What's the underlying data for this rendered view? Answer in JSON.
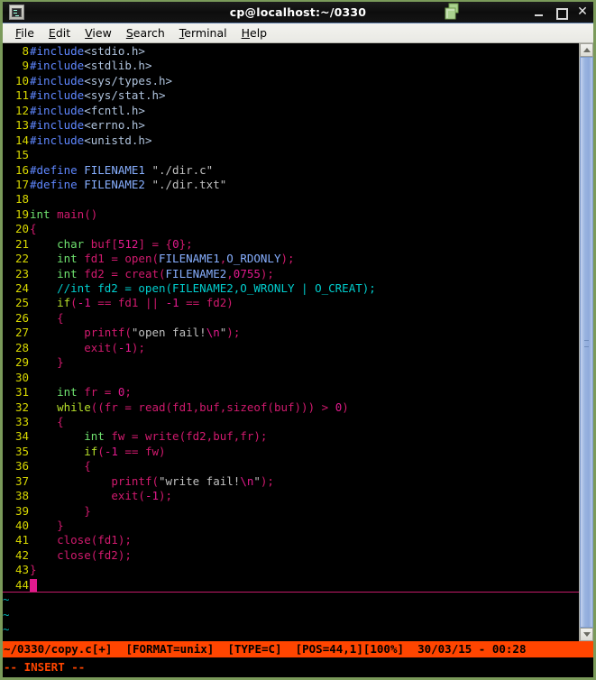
{
  "window": {
    "title": "cp@localhost:~/0330",
    "icon": "terminal-icon",
    "copy_icon": "copy-windows-icon",
    "controls": {
      "minimize": "_",
      "maximize": "□",
      "close": "✕"
    }
  },
  "menubar": {
    "items": [
      {
        "name": "file",
        "mnemonic": "F",
        "rest": "ile"
      },
      {
        "name": "edit",
        "mnemonic": "E",
        "rest": "dit"
      },
      {
        "name": "view",
        "mnemonic": "V",
        "rest": "iew"
      },
      {
        "name": "search",
        "mnemonic": "S",
        "rest": "earch"
      },
      {
        "name": "terminal",
        "mnemonic": "T",
        "rest": "erminal"
      },
      {
        "name": "help",
        "mnemonic": "H",
        "rest": "elp"
      }
    ]
  },
  "editor": {
    "first_line": 8,
    "lines": [
      {
        "n": 8,
        "tokens": [
          {
            "t": "#include",
            "c": "preproc"
          },
          {
            "t": "<stdio.h>",
            "c": "hdr"
          }
        ]
      },
      {
        "n": 9,
        "tokens": [
          {
            "t": "#include",
            "c": "preproc"
          },
          {
            "t": "<stdlib.h>",
            "c": "hdr"
          }
        ]
      },
      {
        "n": 10,
        "tokens": [
          {
            "t": "#include",
            "c": "preproc"
          },
          {
            "t": "<sys/types.h>",
            "c": "hdr"
          }
        ]
      },
      {
        "n": 11,
        "tokens": [
          {
            "t": "#include",
            "c": "preproc"
          },
          {
            "t": "<sys/stat.h>",
            "c": "hdr"
          }
        ]
      },
      {
        "n": 12,
        "tokens": [
          {
            "t": "#include",
            "c": "preproc"
          },
          {
            "t": "<fcntl.h>",
            "c": "hdr"
          }
        ]
      },
      {
        "n": 13,
        "tokens": [
          {
            "t": "#include",
            "c": "preproc"
          },
          {
            "t": "<errno.h>",
            "c": "hdr"
          }
        ]
      },
      {
        "n": 14,
        "tokens": [
          {
            "t": "#include",
            "c": "preproc"
          },
          {
            "t": "<unistd.h>",
            "c": "hdr"
          }
        ]
      },
      {
        "n": 15,
        "tokens": []
      },
      {
        "n": 16,
        "tokens": [
          {
            "t": "#define ",
            "c": "preproc"
          },
          {
            "t": "FILENAME1",
            "c": "macroname"
          },
          {
            "t": " \"./dir.c\"",
            "c": "str"
          }
        ]
      },
      {
        "n": 17,
        "tokens": [
          {
            "t": "#define ",
            "c": "preproc"
          },
          {
            "t": "FILENAME2",
            "c": "macroname"
          },
          {
            "t": " \"./dir.txt\"",
            "c": "str"
          }
        ]
      },
      {
        "n": 18,
        "tokens": []
      },
      {
        "n": 19,
        "tokens": [
          {
            "t": "int",
            "c": "type"
          },
          {
            "t": " ",
            "c": "str"
          },
          {
            "t": "main",
            "c": "func"
          },
          {
            "t": "()",
            "c": "punct"
          }
        ]
      },
      {
        "n": 20,
        "tokens": [
          {
            "t": "{",
            "c": "brace"
          }
        ]
      },
      {
        "n": 21,
        "tokens": [
          {
            "t": "    ",
            "c": "str"
          },
          {
            "t": "char",
            "c": "type"
          },
          {
            "t": " buf[",
            "c": "ident"
          },
          {
            "t": "512",
            "c": "num"
          },
          {
            "t": "] = {",
            "c": "ident"
          },
          {
            "t": "0",
            "c": "num"
          },
          {
            "t": "};",
            "c": "ident"
          }
        ]
      },
      {
        "n": 22,
        "tokens": [
          {
            "t": "    ",
            "c": "str"
          },
          {
            "t": "int",
            "c": "type"
          },
          {
            "t": " fd1 = open(",
            "c": "ident"
          },
          {
            "t": "FILENAME1",
            "c": "macroname"
          },
          {
            "t": ",",
            "c": "ident"
          },
          {
            "t": "O_RDONLY",
            "c": "macroname"
          },
          {
            "t": ");",
            "c": "ident"
          }
        ]
      },
      {
        "n": 23,
        "tokens": [
          {
            "t": "    ",
            "c": "str"
          },
          {
            "t": "int",
            "c": "type"
          },
          {
            "t": " fd2 = creat(",
            "c": "ident"
          },
          {
            "t": "FILENAME2",
            "c": "macroname"
          },
          {
            "t": ",",
            "c": "ident"
          },
          {
            "t": "0755",
            "c": "num"
          },
          {
            "t": ");",
            "c": "ident"
          }
        ]
      },
      {
        "n": 24,
        "tokens": [
          {
            "t": "    //int fd2 = open(FILENAME2,O_WRONLY | O_CREAT);",
            "c": "comment"
          }
        ]
      },
      {
        "n": 25,
        "tokens": [
          {
            "t": "    ",
            "c": "str"
          },
          {
            "t": "if",
            "c": "kw"
          },
          {
            "t": "(",
            "c": "ident"
          },
          {
            "t": "-1",
            "c": "num"
          },
          {
            "t": " == fd1 || ",
            "c": "ident"
          },
          {
            "t": "-1",
            "c": "num"
          },
          {
            "t": " == fd2)",
            "c": "ident"
          }
        ]
      },
      {
        "n": 26,
        "tokens": [
          {
            "t": "    {",
            "c": "brace"
          }
        ]
      },
      {
        "n": 27,
        "tokens": [
          {
            "t": "        ",
            "c": "str"
          },
          {
            "t": "printf",
            "c": "func"
          },
          {
            "t": "(",
            "c": "ident"
          },
          {
            "t": "\"open fail!",
            "c": "str"
          },
          {
            "t": "\\n",
            "c": "esc"
          },
          {
            "t": "\"",
            "c": "str"
          },
          {
            "t": ");",
            "c": "ident"
          }
        ]
      },
      {
        "n": 28,
        "tokens": [
          {
            "t": "        ",
            "c": "str"
          },
          {
            "t": "exit",
            "c": "func"
          },
          {
            "t": "(",
            "c": "ident"
          },
          {
            "t": "-1",
            "c": "num"
          },
          {
            "t": ");",
            "c": "ident"
          }
        ]
      },
      {
        "n": 29,
        "tokens": [
          {
            "t": "    }",
            "c": "brace"
          }
        ]
      },
      {
        "n": 30,
        "tokens": []
      },
      {
        "n": 31,
        "tokens": [
          {
            "t": "    ",
            "c": "str"
          },
          {
            "t": "int",
            "c": "type"
          },
          {
            "t": " fr = ",
            "c": "ident"
          },
          {
            "t": "0",
            "c": "num"
          },
          {
            "t": ";",
            "c": "ident"
          }
        ]
      },
      {
        "n": 32,
        "tokens": [
          {
            "t": "    ",
            "c": "str"
          },
          {
            "t": "while",
            "c": "kw"
          },
          {
            "t": "((fr = read(fd1,buf,sizeof(buf))) > ",
            "c": "ident"
          },
          {
            "t": "0",
            "c": "num"
          },
          {
            "t": ")",
            "c": "ident"
          }
        ]
      },
      {
        "n": 33,
        "tokens": [
          {
            "t": "    {",
            "c": "brace"
          }
        ]
      },
      {
        "n": 34,
        "tokens": [
          {
            "t": "        ",
            "c": "str"
          },
          {
            "t": "int",
            "c": "type"
          },
          {
            "t": " fw = write(fd2,buf,fr);",
            "c": "ident"
          }
        ]
      },
      {
        "n": 35,
        "tokens": [
          {
            "t": "        ",
            "c": "str"
          },
          {
            "t": "if",
            "c": "kw"
          },
          {
            "t": "(",
            "c": "ident"
          },
          {
            "t": "-1",
            "c": "num"
          },
          {
            "t": " == fw)",
            "c": "ident"
          }
        ]
      },
      {
        "n": 36,
        "tokens": [
          {
            "t": "        {",
            "c": "brace"
          }
        ]
      },
      {
        "n": 37,
        "tokens": [
          {
            "t": "            ",
            "c": "str"
          },
          {
            "t": "printf",
            "c": "func"
          },
          {
            "t": "(",
            "c": "ident"
          },
          {
            "t": "\"write fail!",
            "c": "str"
          },
          {
            "t": "\\n",
            "c": "esc"
          },
          {
            "t": "\"",
            "c": "str"
          },
          {
            "t": ");",
            "c": "ident"
          }
        ]
      },
      {
        "n": 38,
        "tokens": [
          {
            "t": "            ",
            "c": "str"
          },
          {
            "t": "exit",
            "c": "func"
          },
          {
            "t": "(",
            "c": "ident"
          },
          {
            "t": "-1",
            "c": "num"
          },
          {
            "t": ");",
            "c": "ident"
          }
        ]
      },
      {
        "n": 39,
        "tokens": [
          {
            "t": "        }",
            "c": "brace"
          }
        ]
      },
      {
        "n": 40,
        "tokens": [
          {
            "t": "    }",
            "c": "brace"
          }
        ]
      },
      {
        "n": 41,
        "tokens": [
          {
            "t": "    close(fd1);",
            "c": "ident"
          }
        ]
      },
      {
        "n": 42,
        "tokens": [
          {
            "t": "    close(fd2);",
            "c": "ident"
          }
        ]
      },
      {
        "n": 43,
        "tokens": [
          {
            "t": "}",
            "c": "brace"
          }
        ]
      },
      {
        "n": 44,
        "tokens": [],
        "cursor": true
      }
    ],
    "empty_marker": "~"
  },
  "statusline": {
    "text": "~/0330/copy.c[+]  [FORMAT=unix]  [TYPE=C]  [POS=44,1][100%]  30/03/15 - 00:28",
    "file": "~/0330/copy.c[+]",
    "format": "[FORMAT=unix]",
    "type": "[TYPE=C]",
    "pos": "[POS=44,1]",
    "percent": "[100%]",
    "datetime": "30/03/15 - 00:28",
    "bg": "#ff4500",
    "fg": "#000000"
  },
  "cmdline": {
    "text": "-- INSERT --",
    "fg": "#ff4500"
  },
  "scrollbar": {
    "up_arrow": "scroll-up-arrow-icon",
    "down_arrow": "scroll-down-arrow-icon",
    "thumb": "scroll-thumb"
  }
}
